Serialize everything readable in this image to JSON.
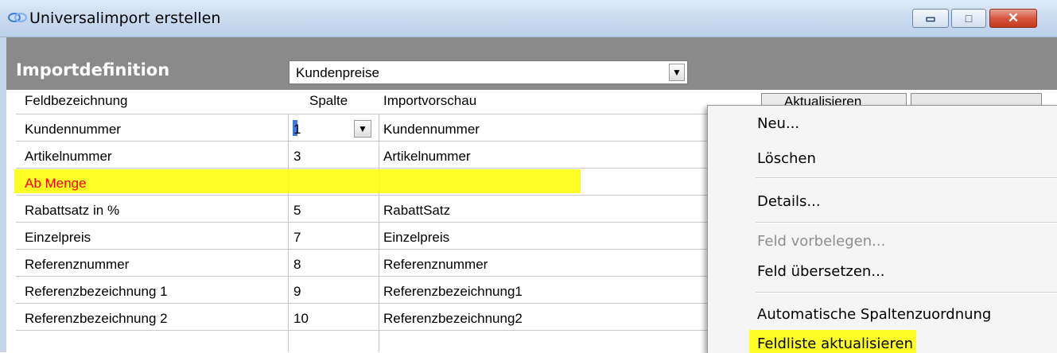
{
  "window": {
    "title": "Universalimport erstellen",
    "minimize_glyph": "▭",
    "maximize_glyph": "□",
    "close_glyph": "✕"
  },
  "header": {
    "label": "Importdefinition",
    "selected_definition": "Kundenpreise",
    "dropdown_glyph": "▼"
  },
  "columns": {
    "field": "Feldbezeichnung",
    "column": "Spalte",
    "preview": "Importvorschau"
  },
  "buttons": {
    "refresh": "Aktualisieren"
  },
  "rows": [
    {
      "field": "Kundennummer",
      "column": "1",
      "preview": "Kundennummer"
    },
    {
      "field": "Artikelnummer",
      "column": "3",
      "preview": "Artikelnummer"
    },
    {
      "field": "Ab Menge",
      "column": "",
      "preview": ""
    },
    {
      "field": "Rabattsatz in %",
      "column": "5",
      "preview": "RabattSatz"
    },
    {
      "field": "Einzelpreis",
      "column": "7",
      "preview": "Einzelpreis"
    },
    {
      "field": "Referenznummer",
      "column": "8",
      "preview": "Referenznummer"
    },
    {
      "field": "Referenzbezeichnung 1",
      "column": "9",
      "preview": "Referenzbezeichnung1"
    },
    {
      "field": "Referenzbezeichnung 2",
      "column": "10",
      "preview": "Referenzbezeichnung2"
    }
  ],
  "context_menu": {
    "items": [
      {
        "label": "Neu...",
        "enabled": true
      },
      {
        "label": "Löschen",
        "enabled": true
      },
      {
        "label": "Details...",
        "enabled": true
      },
      {
        "label": "Feld vorbelegen...",
        "enabled": false
      },
      {
        "label": "Feld übersetzen...",
        "enabled": true
      },
      {
        "label": "Automatische Spaltenzuordnung",
        "enabled": true
      },
      {
        "label": "Feldliste aktualisieren",
        "enabled": true
      }
    ]
  },
  "colors": {
    "highlight": "#ffff00",
    "required_field_text": "#ff0000",
    "header_bar": "#8a8a8a",
    "title_bar": "#c9dbef"
  }
}
